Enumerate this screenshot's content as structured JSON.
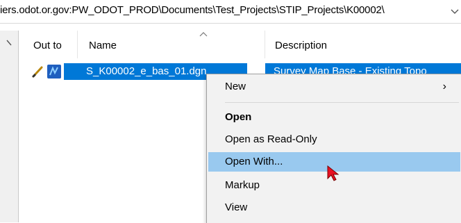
{
  "address_bar": {
    "path": "iers.odot.or.gov:PW_ODOT_PROD\\Documents\\Test_Projects\\STIP_Projects\\K00002\\"
  },
  "columns": {
    "out_to": "Out to",
    "name": "Name",
    "description": "Description"
  },
  "selected_row": {
    "name": "S_K00002_e_bas_01.dgn",
    "description": "Survey Map Base - Existing Topo"
  },
  "context_menu": {
    "new": "New",
    "new_arrow": "›",
    "open": "Open",
    "open_read_only": "Open as Read-Only",
    "open_with": "Open With...",
    "markup": "Markup",
    "view": "View"
  },
  "colors": {
    "selection": "#0078d7",
    "menu_background": "#f2f2f2",
    "menu_hover": "#99c9ef",
    "cursor": "#e81123"
  },
  "icons": [
    "chevron-down-icon",
    "pencil-icon",
    "microstation-file-icon",
    "sort-up-icon",
    "mouse-cursor-icon"
  ]
}
